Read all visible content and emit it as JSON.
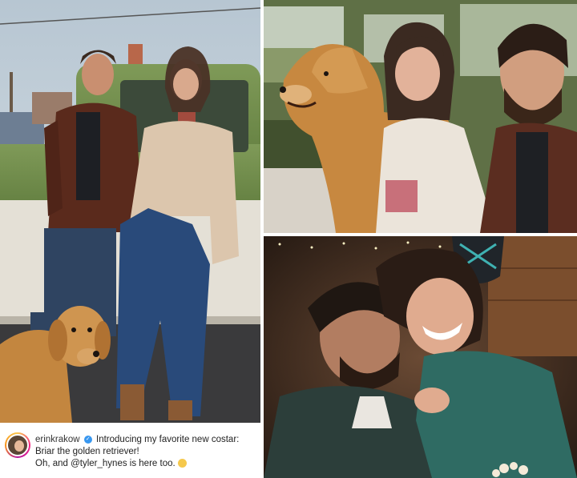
{
  "caption": {
    "username": "erinkrakow",
    "verified_icon": "verified-badge-icon",
    "line1": "Introducing my favorite new costar:",
    "line2": "Briar the golden retriever!",
    "line3": "Oh, and @tyler_hynes is here too.",
    "emoji_icon": "smiling-face-icon"
  },
  "photos": {
    "left": "two-people-and-golden-retriever-by-green-truck",
    "top_right": "couple-with-golden-retriever-in-truck-cab",
    "bottom_right": "couple-laughing-in-cozy-interior"
  },
  "colors": {
    "truck_green": "#6f8a4a",
    "sky": "#c9d6df",
    "dog_gold": "#c98c47",
    "caption_bg": "#ffffff"
  }
}
